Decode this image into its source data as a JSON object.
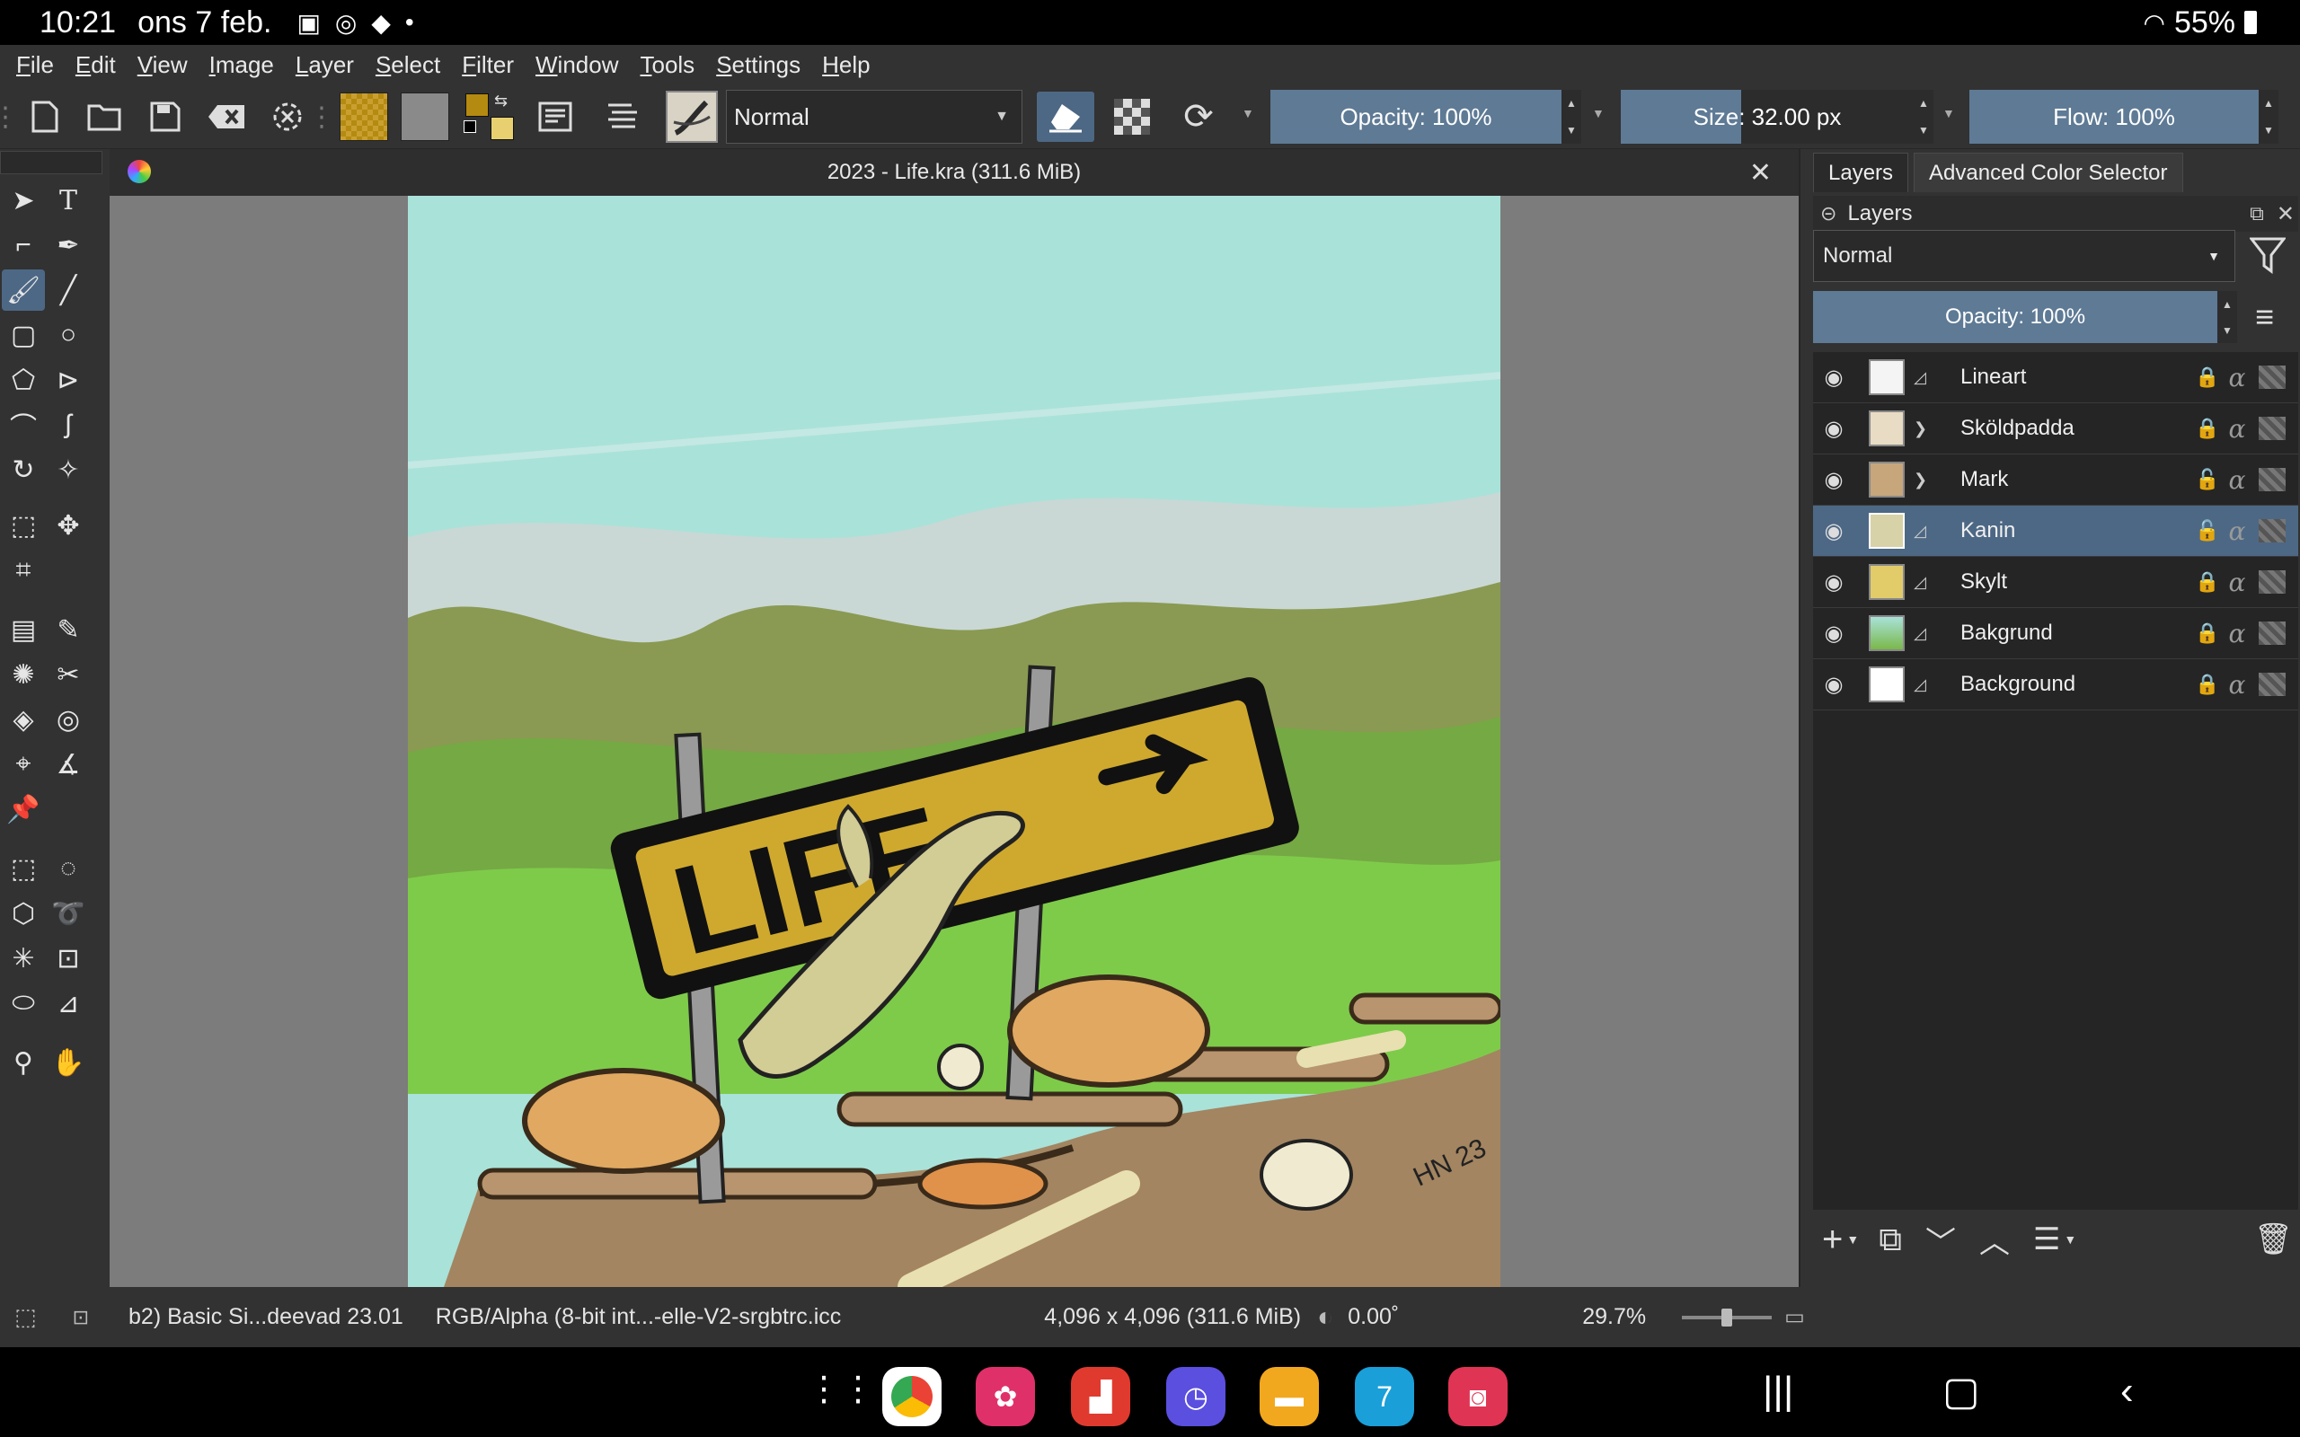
{
  "statusbar": {
    "time": "10:21",
    "date": "ons 7 feb.",
    "battery": "55%",
    "icons": [
      "video-icon",
      "whatsapp-icon",
      "shop-icon",
      "dot-icon"
    ]
  },
  "menu": [
    "File",
    "Edit",
    "View",
    "Image",
    "Layer",
    "Select",
    "Filter",
    "Window",
    "Tools",
    "Settings",
    "Help"
  ],
  "toolbar": {
    "blend_mode": "Normal",
    "opacity": "Opacity: 100%",
    "opacity_fraction": 1.0,
    "size": "Size: 32.00 px",
    "flow": "Flow: 100%",
    "colors": {
      "foreground": "#b58a10",
      "background": "#e8d070"
    }
  },
  "document": {
    "title": "2023 - Life.kra (311.6 MiB)"
  },
  "dock": {
    "tabs": [
      "Layers",
      "Advanced Color Selector"
    ],
    "panel_title": "Layers",
    "blend_mode": "Normal",
    "opacity": "Opacity:  100%",
    "layers": [
      {
        "name": "Lineart",
        "type": "paint",
        "locked": true,
        "selected": false
      },
      {
        "name": "Sköldpadda",
        "type": "group",
        "locked": true,
        "selected": false
      },
      {
        "name": "Mark",
        "type": "group",
        "locked": false,
        "selected": false
      },
      {
        "name": "Kanin",
        "type": "paint",
        "locked": false,
        "selected": true
      },
      {
        "name": "Skylt",
        "type": "paint",
        "locked": true,
        "selected": false
      },
      {
        "name": "Bakgrund",
        "type": "paint",
        "locked": true,
        "selected": false
      },
      {
        "name": "Background",
        "type": "paint",
        "locked": true,
        "selected": false
      }
    ]
  },
  "statusline": {
    "brush": "b2) Basic Si...deevad 23.01",
    "colorspace": "RGB/Alpha (8-bit int...-elle-V2-srgbtrc.icc",
    "dimensions": "4,096 x 4,096 (311.6 MiB)",
    "rotation": "0.00˚",
    "zoom": "29.7%"
  },
  "artwork_text": "LIFE",
  "signature": "HN 23"
}
